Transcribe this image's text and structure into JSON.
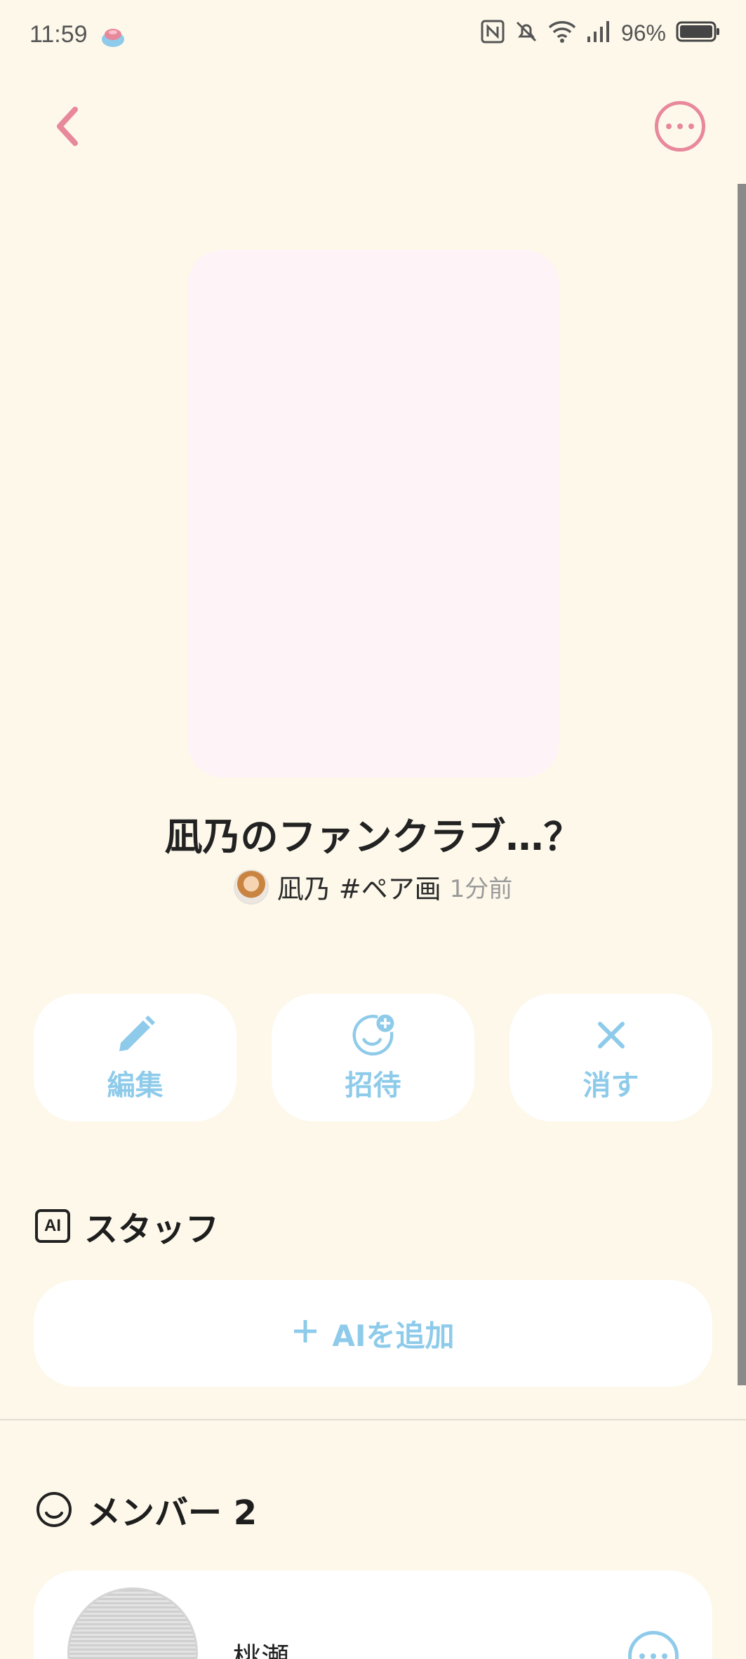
{
  "status_bar": {
    "time": "11:59",
    "battery_percent": "96%",
    "icons": [
      "nfc-icon",
      "bell-off-icon",
      "wifi-icon",
      "signal-icon",
      "battery-icon"
    ]
  },
  "header": {
    "back_icon": "chevron-left-icon",
    "more_icon": "more-circle-icon",
    "accent_color": "#e8889b"
  },
  "room": {
    "title": "凪乃のファンクラブ…？",
    "author": "凪乃 #ペア画",
    "time_ago": "1分前"
  },
  "actions": [
    {
      "label": "編集",
      "icon": "pencil-icon"
    },
    {
      "label": "招待",
      "icon": "add-person-icon"
    },
    {
      "label": "消す",
      "icon": "close-icon"
    }
  ],
  "staff": {
    "badge": "AI",
    "title": "スタッフ",
    "add_label": "AIを追加"
  },
  "members": {
    "title": "メンバー 2",
    "list": [
      {
        "name": "桃瀬。"
      }
    ]
  },
  "colors": {
    "background": "#fdf8ea",
    "action_blue": "#8ecbea",
    "cover_pink": "#fef3f6"
  }
}
